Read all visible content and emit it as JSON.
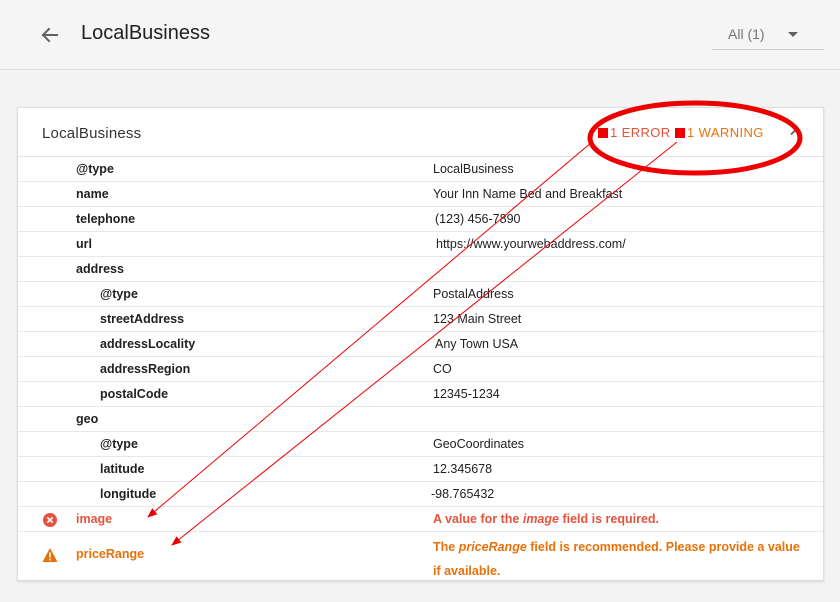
{
  "header": {
    "title": "LocalBusiness",
    "filter_value": "All (1)"
  },
  "card": {
    "title": "LocalBusiness",
    "error_badge": "1 ERROR",
    "warning_badge": "1 WARNING",
    "rows": [
      {
        "key": "@type",
        "value": "LocalBusiness"
      },
      {
        "key": "name",
        "value": "Your Inn Name Bed and Breakfast"
      },
      {
        "key": "telephone",
        "value": "(123) 456-7890"
      },
      {
        "key": "url",
        "value": "https://www.yourwebaddress.com/"
      },
      {
        "key": "address",
        "value": ""
      },
      {
        "key": "@type",
        "value": "PostalAddress"
      },
      {
        "key": "streetAddress",
        "value": "123 Main Street"
      },
      {
        "key": "addressLocality",
        "value": "Any Town USA"
      },
      {
        "key": "addressRegion",
        "value": "CO"
      },
      {
        "key": "postalCode",
        "value": "12345-1234"
      },
      {
        "key": "geo",
        "value": ""
      },
      {
        "key": "@type",
        "value": "GeoCoordinates"
      },
      {
        "key": "latitude",
        "value": "12.345678"
      },
      {
        "key": "longitude",
        "value": "-98.765432"
      }
    ],
    "error": {
      "key": "image",
      "msg_before": "A value for the ",
      "msg_field": "image",
      "msg_after": " field is required."
    },
    "warning": {
      "key": "priceRange",
      "msg_before": "The ",
      "msg_field": "priceRange",
      "msg_after": " field is recommended. Please provide a value if available."
    }
  },
  "colors": {
    "error": "#e5533d",
    "warning": "#e8710a",
    "annotation": "#ee0000"
  },
  "icons": {
    "back": "arrow-back-icon",
    "dropdown": "chevron-down-icon",
    "collapse": "chevron-up-icon",
    "error": "error-circle-icon",
    "warning": "warning-triangle-icon"
  }
}
